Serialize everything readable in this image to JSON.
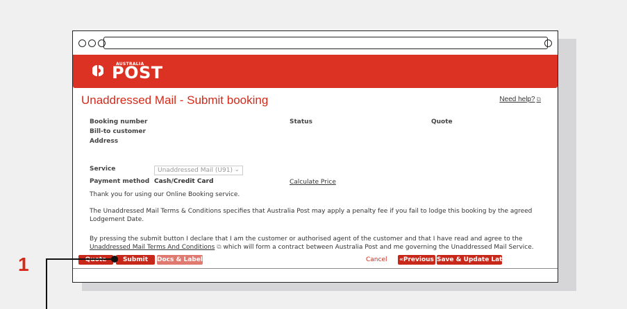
{
  "brand": {
    "small": "AUSTRALIA",
    "big": "POST",
    "color": "#dc3223"
  },
  "page": {
    "title": "Unaddressed Mail - Submit booking",
    "help_link": "Need help?",
    "help_icon": "external-link-icon"
  },
  "fields": {
    "booking_number": "Booking number",
    "bill_to": "Bill-to customer",
    "address": "Address",
    "status": "Status",
    "quote": "Quote",
    "service_label": "Service",
    "service_value": "Unaddressed Mail (U91)",
    "payment_label": "Payment method",
    "payment_value": "Cash/Credit Card",
    "calculate": "Calculate Price"
  },
  "messages": {
    "thanks": "Thank you for using our Online Booking service.",
    "terms_notice": "The Unaddressed Mail Terms & Conditions specifies that Australia Post may apply a penalty fee if you fail to lodge this booking by the agreed Lodgement Date.",
    "declare_prefix": "By pressing the submit button I declare that I am the customer or authorised agent of the customer and that I have read and agree to the",
    "terms_link": "Unaddressed Mail Terms And Conditions",
    "declare_suffix": "which will form a contract between Australia Post and me governing the Unaddressed Mail Service."
  },
  "buttons": {
    "quote": "Quote",
    "submit": "Submit",
    "docs": "Docs & Labels",
    "cancel": "Cancel",
    "previous": "«Previous",
    "save": "Save & Update Later"
  },
  "callout": {
    "number": "1"
  }
}
